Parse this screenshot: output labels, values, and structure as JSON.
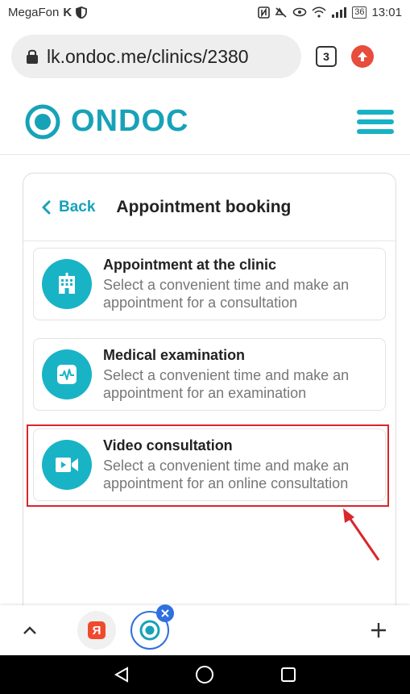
{
  "status": {
    "carrier": "MegaFon",
    "carrier_suffix": "K",
    "battery": "36",
    "time": "13:01"
  },
  "browser": {
    "url": "lk.ondoc.me/clinics/2380",
    "tab_count": "3"
  },
  "site": {
    "brand": "ONDOC",
    "accent": "#17a2b8"
  },
  "panel": {
    "back_label": "Back",
    "title": "Appointment booking"
  },
  "options": [
    {
      "title": "Appointment at the clinic",
      "desc": "Select a convenient time and make an appointment for a consultation",
      "icon": "hospital-icon"
    },
    {
      "title": "Medical examination",
      "desc": "Select a convenient time and make an appointment for an examination",
      "icon": "pulse-icon"
    },
    {
      "title": "Video consultation",
      "desc": "Select a convenient time and make an appointment for an online consultation",
      "icon": "video-camera-icon"
    }
  ],
  "bottom": {
    "yandex_label": "Я"
  }
}
